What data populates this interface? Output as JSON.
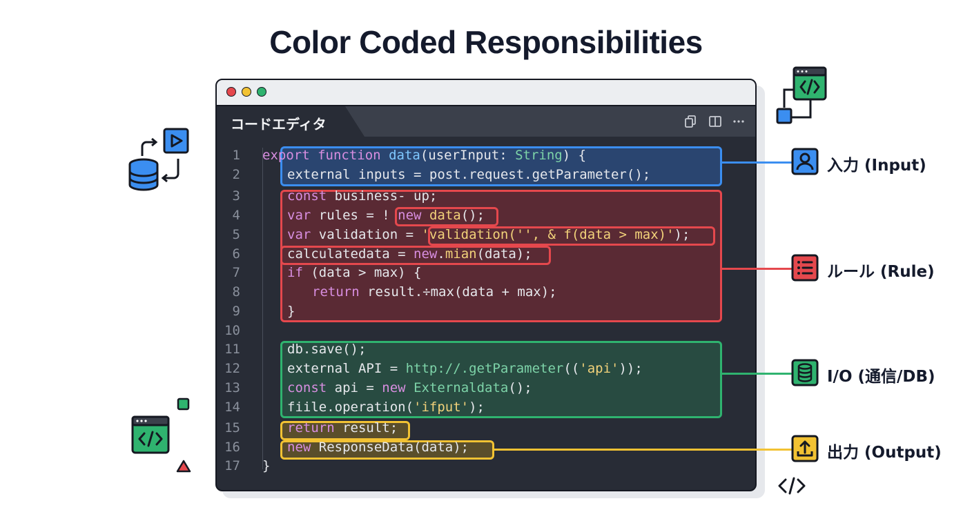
{
  "title": "Color Coded Responsibilities",
  "editor": {
    "tab_label": "コードエディタ",
    "line_numbers": [
      "1",
      "2",
      "3",
      "4",
      "5",
      "6",
      "7",
      "8",
      "9",
      "10",
      "11",
      "12",
      "13",
      "14",
      "15",
      "16",
      "17"
    ]
  },
  "annotations": {
    "input": "入力 (Input)",
    "rule": "ルール (Rule)",
    "io": "I/O (通信/DB)",
    "output": "出力 (Output)"
  },
  "colors": {
    "input": "#3b8ef0",
    "rule": "#e5484d",
    "io": "#2fb36f",
    "output": "#f2c233"
  },
  "icons": {
    "input": "user-icon",
    "rule": "list-icon",
    "io": "database-icon",
    "output": "upload-icon"
  }
}
